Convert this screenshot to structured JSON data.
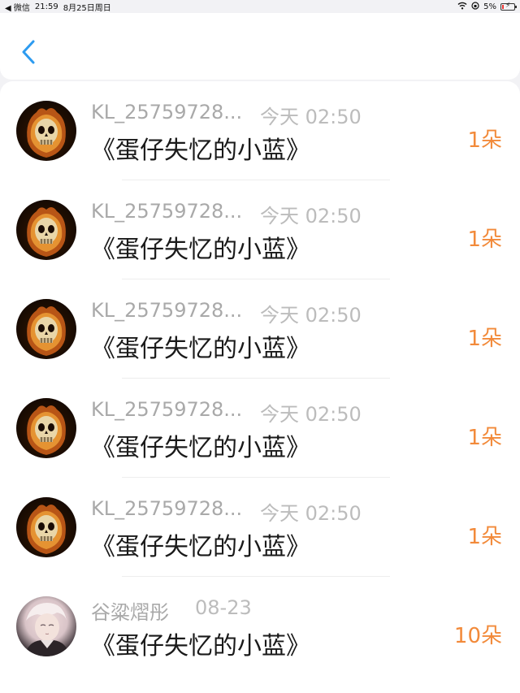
{
  "status_bar": {
    "back_app": "◀ 微信",
    "time": "21:59",
    "date": "8月25日周日",
    "battery": "5%"
  },
  "nav": {
    "back_icon": "chevron-left-icon"
  },
  "gift_records": [
    {
      "user": "KL_25759728...",
      "time": "今天 02:50",
      "gift": "《蛋仔失忆的小蓝》",
      "count": "1朵",
      "avatar": "skull"
    },
    {
      "user": "KL_25759728...",
      "time": "今天 02:50",
      "gift": "《蛋仔失忆的小蓝》",
      "count": "1朵",
      "avatar": "skull"
    },
    {
      "user": "KL_25759728...",
      "time": "今天 02:50",
      "gift": "《蛋仔失忆的小蓝》",
      "count": "1朵",
      "avatar": "skull"
    },
    {
      "user": "KL_25759728...",
      "time": "今天 02:50",
      "gift": "《蛋仔失忆的小蓝》",
      "count": "1朵",
      "avatar": "skull"
    },
    {
      "user": "KL_25759728...",
      "time": "今天 02:50",
      "gift": "《蛋仔失忆的小蓝》",
      "count": "1朵",
      "avatar": "skull"
    },
    {
      "user": "谷粱熠彤",
      "time": "08-23",
      "gift": "《蛋仔失忆的小蓝》",
      "count": "10朵",
      "avatar": "anime"
    }
  ],
  "colors": {
    "accent": "#f28a3a",
    "back": "#2d9bf0"
  }
}
